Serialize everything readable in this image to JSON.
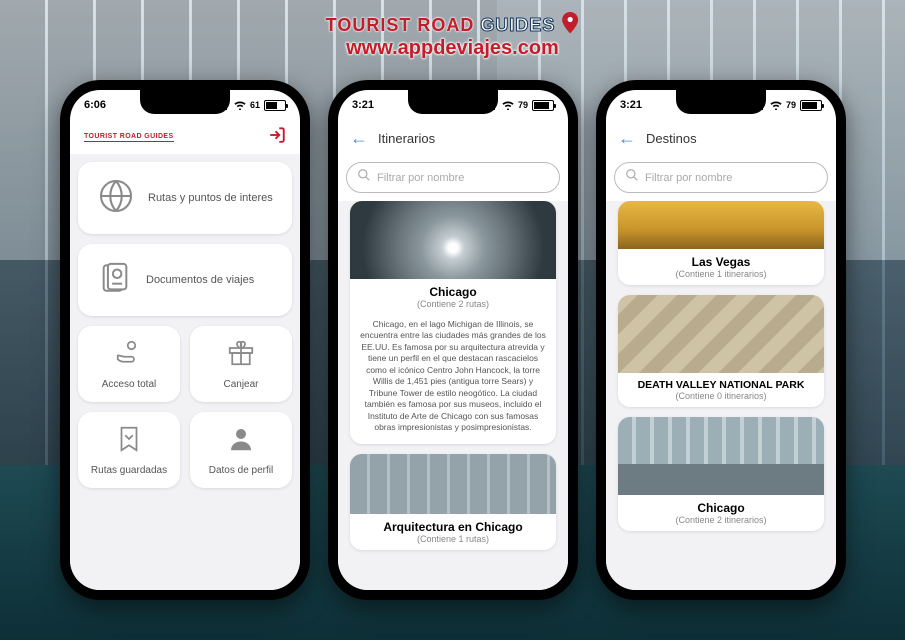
{
  "banner": {
    "line1a": "TOURIST ROAD ",
    "line1b": "GUIDES",
    "line2": "www.appdeviajes.com"
  },
  "phone1": {
    "time": "6:06",
    "battery": "61",
    "logo": "TOURIST ROAD GUIDES",
    "menu": {
      "routes": "Rutas y puntos de interes",
      "docs": "Documentos de viajes",
      "access": "Acceso total",
      "redeem": "Canjear",
      "saved": "Rutas guardadas",
      "profile": "Datos de perfil"
    }
  },
  "phone2": {
    "time": "3:21",
    "battery": "79",
    "header": "Itinerarios",
    "search_ph": "Filtrar por nombre",
    "card1": {
      "title": "Chicago",
      "sub": "(Contiene 2 rutas)",
      "desc": "Chicago, en el lago Michigan de Illinois, se encuentra entre las ciudades más grandes de los EE.UU. Es famosa por su arquitectura atrevida y tiene un perfil en el que destacan rascacielos como el icónico Centro John Hancock, la torre Willis de 1,451 pies (antigua torre Sears) y Tribune Tower de estilo neogótico. La ciudad también es famosa por sus museos, incluido el Instituto de Arte de Chicago con sus famosas obras impresionistas y posimpresionistas."
    },
    "card2": {
      "title": "Arquitectura en Chicago",
      "sub": "(Contiene 1 rutas)"
    }
  },
  "phone3": {
    "time": "3:21",
    "battery": "79",
    "header": "Destinos",
    "search_ph": "Filtrar por nombre",
    "card1": {
      "title": "Las Vegas",
      "sub": "(Contiene 1 itinerarios)"
    },
    "card2": {
      "title": "DEATH VALLEY NATIONAL PARK",
      "sub": "(Contiene 0 itinerarios)"
    },
    "card3": {
      "title": "Chicago",
      "sub": "(Contiene 2 itinerarios)"
    }
  }
}
